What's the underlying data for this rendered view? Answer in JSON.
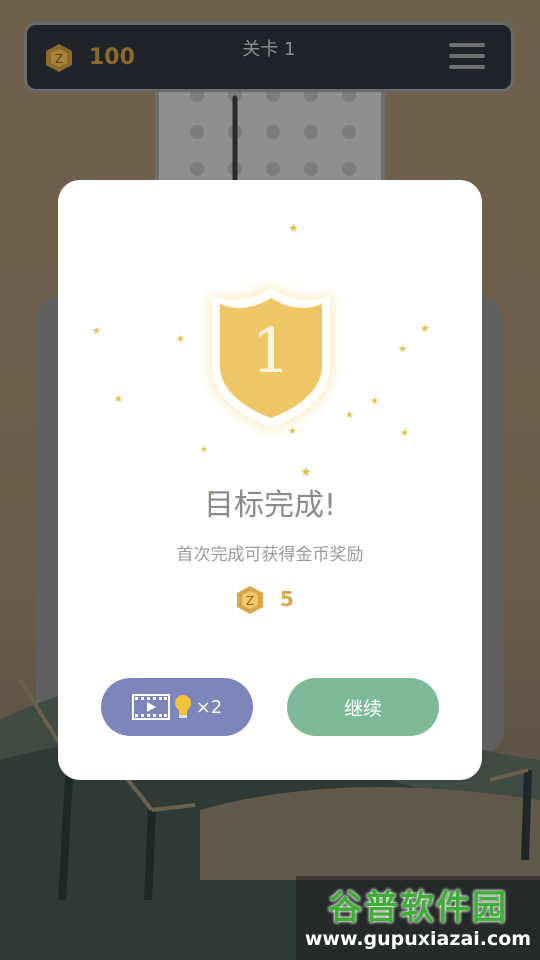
{
  "header": {
    "coin_count": "100",
    "level_title": "关卡 1"
  },
  "modal": {
    "badge_number": "1",
    "title": "目标完成!",
    "subtitle": "首次完成可获得金币奖励",
    "reward_amount": "5",
    "video_button": {
      "multiplier": "×2"
    },
    "continue_label": "继续"
  },
  "watermark": {
    "title": "谷普软件园",
    "url": "www.gupuxiazai.com"
  },
  "colors": {
    "modal_bg": "#ffffff",
    "badge_gold": "#efc766",
    "video_button": "#7d86ba",
    "continue_button": "#7cba98",
    "topbar_bg": "#1f2229",
    "coin_gold": "#d7a84b"
  },
  "icons": [
    "coin-icon",
    "menu-icon",
    "video-icon",
    "lightbulb-icon",
    "star-icon"
  ]
}
